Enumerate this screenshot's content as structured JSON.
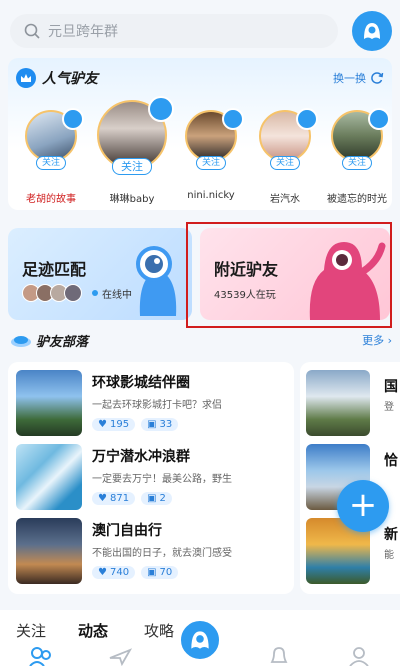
{
  "search": {
    "placeholder": "元旦跨年群"
  },
  "popular": {
    "title": "人气驴友",
    "refresh_label": "换一换",
    "users": [
      {
        "name": "老胡的故事",
        "follow": "关注"
      },
      {
        "name": "琳琳baby",
        "follow": "关注"
      },
      {
        "name": "nini.nicky",
        "follow": "关注"
      },
      {
        "name": "岩汽水",
        "follow": "关注"
      },
      {
        "name": "被遗忘的时光",
        "follow": "关注"
      }
    ]
  },
  "cards": {
    "match": {
      "title": "足迹匹配",
      "status": "在线中"
    },
    "nearby": {
      "title": "附近驴友",
      "subtitle": "43539人在玩"
    }
  },
  "tribe": {
    "title": "驴友部落",
    "more": "更多",
    "groups": [
      {
        "name": "环球影城结伴圈",
        "desc": "一起去环球影城打卡吧？求侣",
        "likes": "195",
        "posts": "33"
      },
      {
        "name": "万宁潜水冲浪群",
        "desc": "一定要去万宁！最美公路，野生",
        "likes": "871",
        "posts": "2"
      },
      {
        "name": "澳门自由行",
        "desc": "不能出国的日子，就去澳门感受",
        "likes": "740",
        "posts": "70"
      }
    ],
    "side": [
      {
        "name": "国",
        "desc": "登"
      },
      {
        "name": "恰",
        "desc": ""
      },
      {
        "name": "新",
        "desc": "能"
      }
    ]
  },
  "bottom_nav": {
    "follow": "关注",
    "feed": "动态",
    "guide": "攻略"
  },
  "colors": {
    "accent": "#2d9bf0",
    "highlight": "#d11d1d"
  }
}
